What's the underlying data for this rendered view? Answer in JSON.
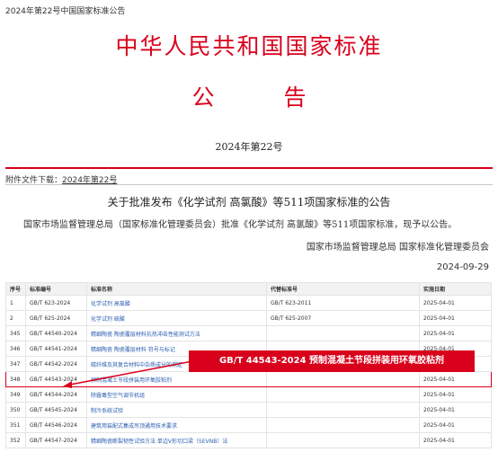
{
  "page": {
    "top_title": "2024年第22号中国国家标准公告",
    "heading": "中华人民共和国国家标准",
    "subheading": "公　告",
    "issue": "2024年第22号",
    "attachment_label": "附件文件下载：",
    "attachment_link": "2024年第22号",
    "announcement_title": "关于批准发布《化学试剂 高氯酸》等511项国家标准的公告",
    "announcement_body": "国家市场监督管理总局（国家标准化管理委员会）批准《化学试剂 高氯酸》等511项国家标准，现予以公告。",
    "issuer": "国家市场监督管理总局 国家标准化管理委员会",
    "date": "2024-09-29"
  },
  "table": {
    "headers": [
      "序号",
      "标准编号",
      "标准名称",
      "代替标准号",
      "实施日期"
    ],
    "rows": [
      [
        "1",
        "GB/T 623-2024",
        "化学试剂 高氯酸",
        "GB/T 623-2011",
        "2025-04-01"
      ],
      [
        "2",
        "GB/T 625-2024",
        "化学试剂 硫酸",
        "GB/T 625-2007",
        "2025-04-01"
      ],
      [
        "345",
        "GB/T 44540-2024",
        "精细陶瓷 陶瓷覆层材料抗热冲击性能测试方法",
        "",
        "2025-04-01"
      ],
      [
        "346",
        "GB/T 44541-2024",
        "精细陶瓷 陶瓷覆层材料 符号与标记",
        "",
        "2025-04-01"
      ],
      [
        "347",
        "GB/T 44542-2024",
        "碳纤维及其复合材料中杂质成分的测定",
        "",
        "2025-04-01"
      ],
      [
        "348",
        "GB/T 44543-2024",
        "预制混凝土节段拼装用环氧胶粘剂",
        "",
        "2025-04-01"
      ],
      [
        "349",
        "GB/T 44544-2024",
        "除霾毒型空气调节机组",
        "",
        "2025-04-01"
      ],
      [
        "350",
        "GB/T 44545-2024",
        "制冷系统试验",
        "",
        "2025-04-01"
      ],
      [
        "351",
        "GB/T 44546-2024",
        "建筑用装配式集成吊顶通用技术要求",
        "",
        "2025-04-01"
      ],
      [
        "352",
        "GB/T 44547-2024",
        "精细陶瓷断裂韧性试验方法 单边V形切口梁（SEVNB）法",
        "",
        "2025-04-01"
      ]
    ]
  },
  "callout": "GB/T 44543-2024 预制混凝土节段拼装用环氧胶粘剂",
  "colors": {
    "accent": "#d9001b",
    "link": "#2a5db0"
  }
}
